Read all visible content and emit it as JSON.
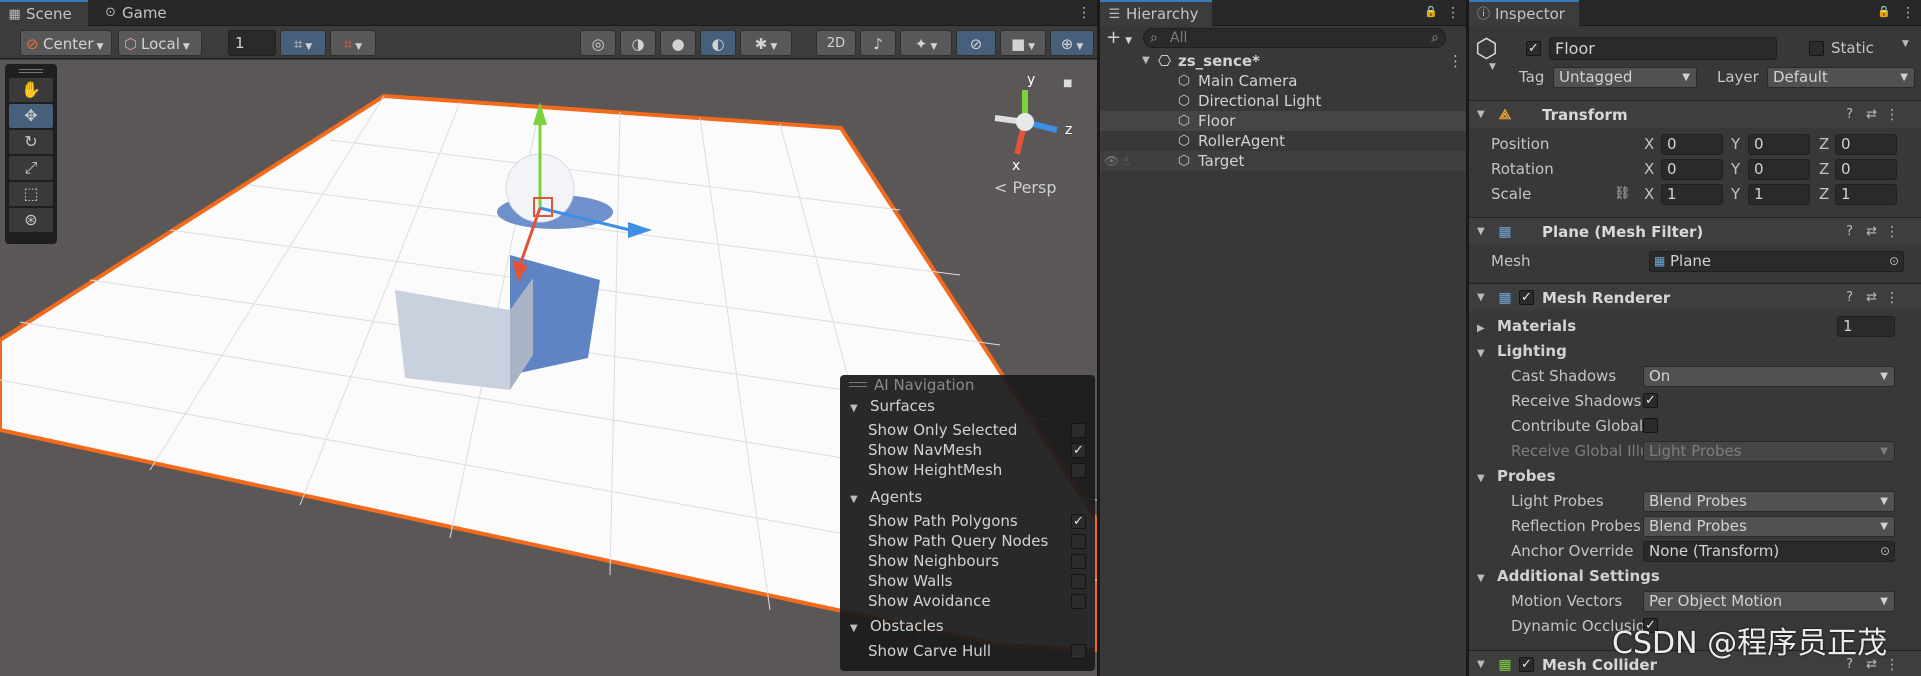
{
  "scene_panel": {
    "tabs": [
      {
        "label": "Scene",
        "icon": "grid-icon"
      },
      {
        "label": "Game",
        "icon": "gamepad-icon"
      }
    ],
    "toolbar": {
      "pivot_mode": "Center",
      "pivot_rotation": "Local",
      "grid_snap_value": "1",
      "mode_2d": "2D"
    },
    "persp_label": "< Persp",
    "gizmo_axes": {
      "y": "y",
      "z": "z",
      "x": "x"
    },
    "ai_navigation": {
      "title": "AI Navigation",
      "sections": [
        {
          "name": "Surfaces",
          "options": [
            {
              "label": "Show Only Selected",
              "checked": false
            },
            {
              "label": "Show NavMesh",
              "checked": true
            },
            {
              "label": "Show HeightMesh",
              "checked": false
            }
          ]
        },
        {
          "name": "Agents",
          "options": [
            {
              "label": "Show Path Polygons",
              "checked": true
            },
            {
              "label": "Show Path Query Nodes",
              "checked": false
            },
            {
              "label": "Show Neighbours",
              "checked": false
            },
            {
              "label": "Show Walls",
              "checked": false
            },
            {
              "label": "Show Avoidance",
              "checked": false
            }
          ]
        },
        {
          "name": "Obstacles",
          "options": [
            {
              "label": "Show Carve Hull",
              "checked": false
            }
          ]
        }
      ]
    }
  },
  "hierarchy": {
    "tab_label": "Hierarchy",
    "add_label": "+",
    "search_placeholder": "All",
    "scene_name": "zs_sence*",
    "items": [
      {
        "label": "Main Camera",
        "selected": false
      },
      {
        "label": "Directional Light",
        "selected": false
      },
      {
        "label": "Floor",
        "selected": true
      },
      {
        "label": "RollerAgent",
        "selected": false
      },
      {
        "label": "Target",
        "selected": false
      }
    ]
  },
  "inspector": {
    "tab_label": "Inspector",
    "object_name": "Floor",
    "static_label": "Static",
    "tag_label": "Tag",
    "tag_value": "Untagged",
    "layer_label": "Layer",
    "layer_value": "Default",
    "transform": {
      "title": "Transform",
      "position": {
        "label": "Position",
        "x": "0",
        "y": "0",
        "z": "0"
      },
      "rotation": {
        "label": "Rotation",
        "x": "0",
        "y": "0",
        "z": "0"
      },
      "scale": {
        "label": "Scale",
        "x": "1",
        "y": "1",
        "z": "1"
      }
    },
    "mesh_filter": {
      "title": "Plane (Mesh Filter)",
      "mesh_label": "Mesh",
      "mesh_value": "Plane"
    },
    "mesh_renderer": {
      "title": "Mesh Renderer",
      "materials_label": "Materials",
      "materials_count": "1",
      "lighting_label": "Lighting",
      "cast_shadows_label": "Cast Shadows",
      "cast_shadows_value": "On",
      "receive_shadows_label": "Receive Shadows",
      "contribute_gi_label": "Contribute Global",
      "receive_gi_label": "Receive Global Illu",
      "receive_gi_value": "Light Probes",
      "probes_label": "Probes",
      "light_probes_label": "Light Probes",
      "light_probes_value": "Blend Probes",
      "reflection_probes_label": "Reflection Probes",
      "reflection_probes_value": "Blend Probes",
      "anchor_override_label": "Anchor Override",
      "anchor_override_value": "None (Transform)",
      "additional_label": "Additional Settings",
      "motion_vectors_label": "Motion Vectors",
      "motion_vectors_value": "Per Object Motion",
      "dynamic_occlusion_label": "Dynamic Occlusio"
    },
    "mesh_collider": {
      "title": "Mesh Collider"
    }
  },
  "watermark": "CSDN @程序员正茂",
  "colors": {
    "accent": "#3a79bb",
    "selection_outline": "#f26b1d",
    "active_tool": "#46607c"
  }
}
